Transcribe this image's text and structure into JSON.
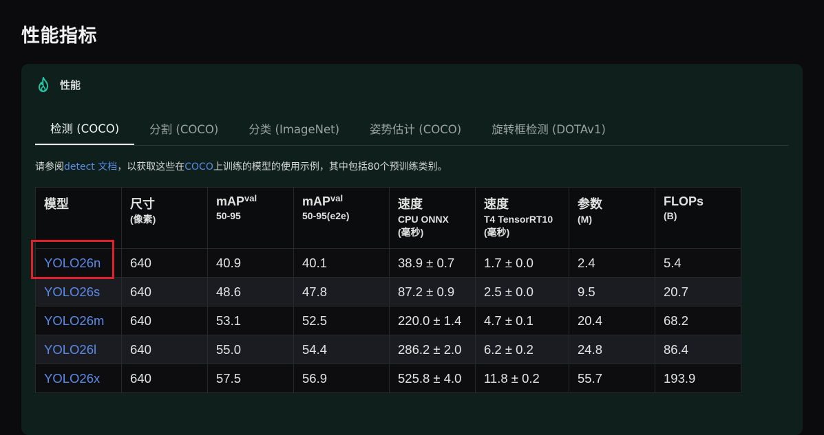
{
  "page_title": "性能指标",
  "panel": {
    "title": "性能",
    "icon": "flame-icon",
    "accent_color": "#26c6a4"
  },
  "tabs": [
    {
      "label": "检测 (COCO)",
      "active": true
    },
    {
      "label": "分割 (COCO)",
      "active": false
    },
    {
      "label": "分类 (ImageNet)",
      "active": false
    },
    {
      "label": "姿势估计 (COCO)",
      "active": false
    },
    {
      "label": "旋转框检测 (DOTAv1)",
      "active": false
    }
  ],
  "note": {
    "prefix": "请参阅",
    "link1": "detect 文档",
    "middle": "，以获取这些在",
    "link2": "COCO",
    "suffix": "上训练的模型的使用示例，其中包括80个预训练类别。"
  },
  "table": {
    "headers": [
      {
        "main": "模型",
        "sup": "",
        "sub1": "",
        "sub2": ""
      },
      {
        "main": "尺寸",
        "sup": "",
        "sub1": "(像素)",
        "sub2": ""
      },
      {
        "main": "mAP",
        "sup": "val",
        "sub1": "50-95",
        "sub2": ""
      },
      {
        "main": "mAP",
        "sup": "val",
        "sub1": "50-95(e2e)",
        "sub2": ""
      },
      {
        "main": "速度",
        "sup": "",
        "sub1": "CPU ONNX",
        "sub2": "(毫秒)"
      },
      {
        "main": "速度",
        "sup": "",
        "sub1": "T4 TensorRT10",
        "sub2": "(毫秒)"
      },
      {
        "main": "参数",
        "sup": "",
        "sub1": "(M)",
        "sub2": ""
      },
      {
        "main": "FLOPs",
        "sup": "",
        "sub1": "(B)",
        "sub2": ""
      }
    ],
    "rows": [
      [
        "YOLO26n",
        "640",
        "40.9",
        "40.1",
        "38.9 ± 0.7",
        "1.7 ± 0.0",
        "2.4",
        "5.4"
      ],
      [
        "YOLO26s",
        "640",
        "48.6",
        "47.8",
        "87.2 ± 0.9",
        "2.5 ± 0.0",
        "9.5",
        "20.7"
      ],
      [
        "YOLO26m",
        "640",
        "53.1",
        "52.5",
        "220.0 ± 1.4",
        "4.7 ± 0.1",
        "20.4",
        "68.2"
      ],
      [
        "YOLO26l",
        "640",
        "55.0",
        "54.4",
        "286.2 ± 2.0",
        "6.2 ± 0.2",
        "24.8",
        "86.4"
      ],
      [
        "YOLO26x",
        "640",
        "57.5",
        "56.9",
        "525.8 ± 4.0",
        "11.8 ± 0.2",
        "55.7",
        "193.9"
      ]
    ]
  },
  "colors": {
    "background": "#0b0b0e",
    "panel": "#0e1f1c",
    "link": "#5b8be8",
    "highlight_box": "#e0202c"
  }
}
